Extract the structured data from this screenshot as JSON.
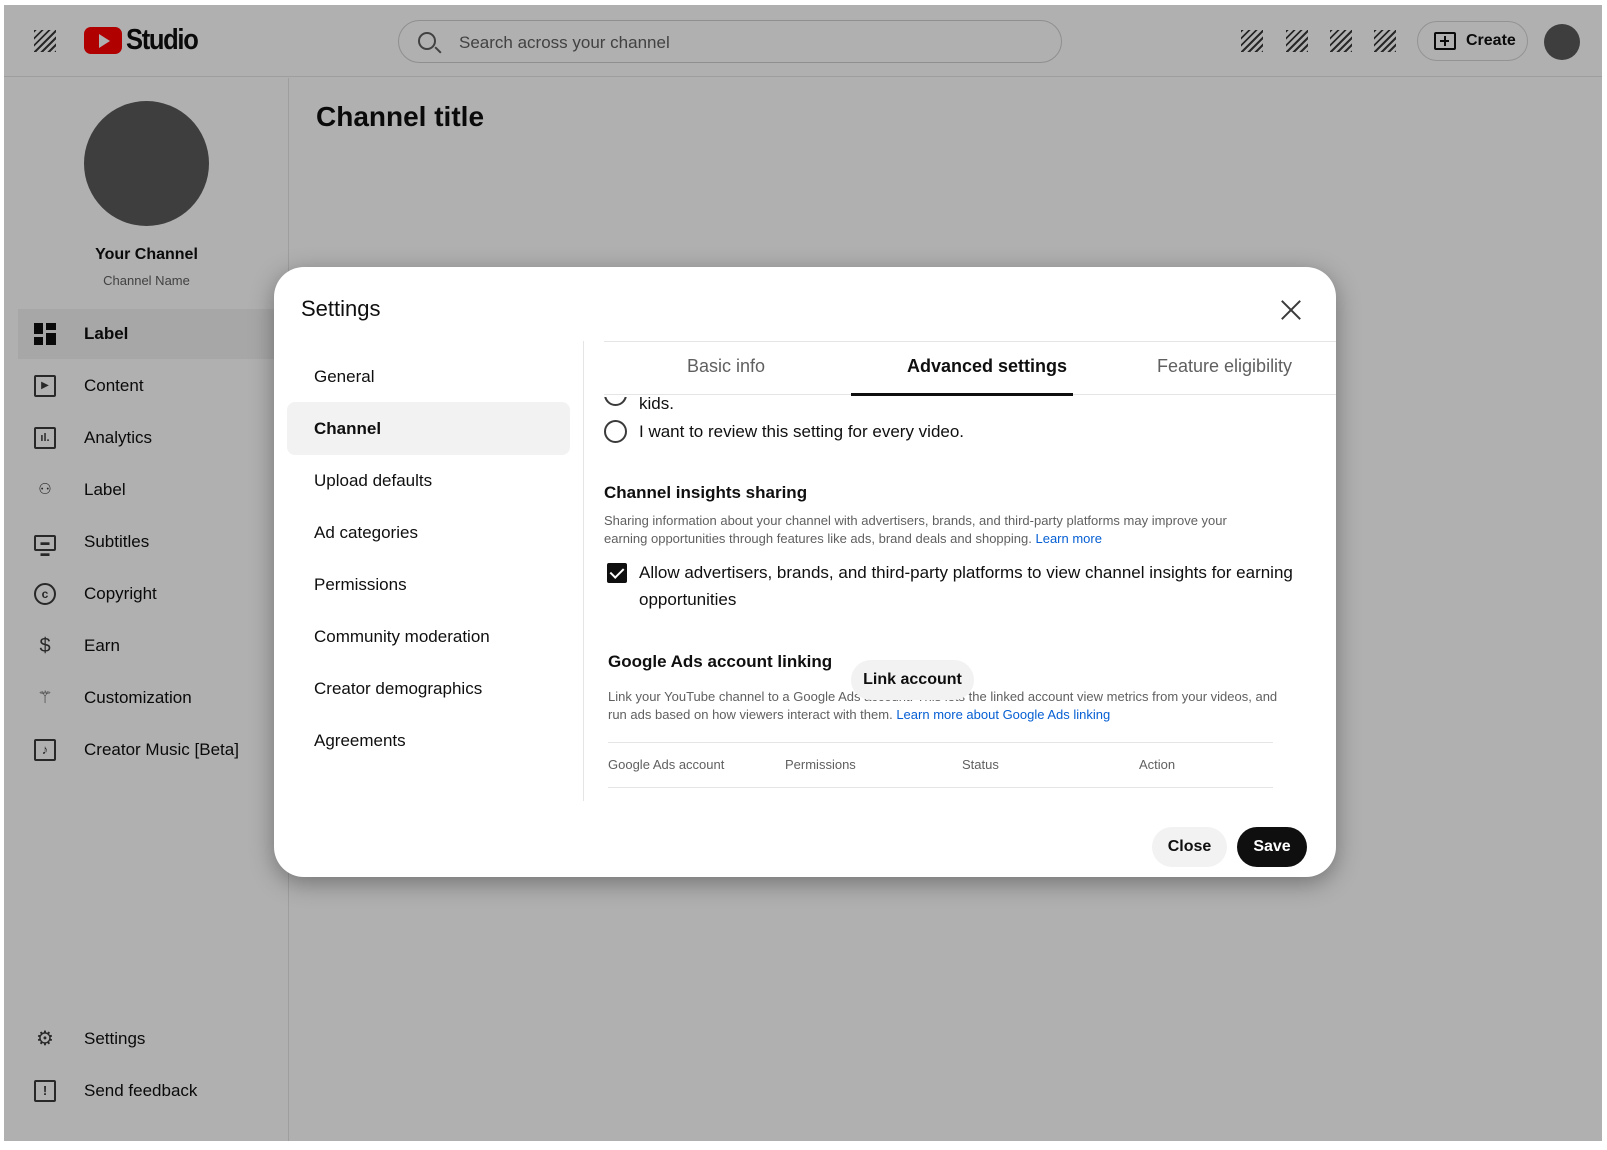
{
  "topbar": {
    "logo_text": "Studio",
    "search_placeholder": "Search across your channel",
    "create_label": "Create"
  },
  "page": {
    "title": "Channel title"
  },
  "sidebar": {
    "channel_name": "Your Channel",
    "channel_handle": "Channel Name",
    "items": [
      {
        "label": "Label",
        "icon": "dashboard-icon"
      },
      {
        "label": "Content",
        "icon": "content-icon"
      },
      {
        "label": "Analytics",
        "icon": "analytics-icon"
      },
      {
        "label": "Label",
        "icon": "community-icon"
      },
      {
        "label": "Subtitles",
        "icon": "subtitles-icon"
      },
      {
        "label": "Copyright",
        "icon": "copyright-icon"
      },
      {
        "label": "Earn",
        "icon": "earn-icon"
      },
      {
        "label": "Customization",
        "icon": "customization-icon"
      },
      {
        "label": "Creator Music [Beta]",
        "icon": "music-icon"
      }
    ],
    "bottom": [
      {
        "label": "Settings",
        "icon": "gear-icon"
      },
      {
        "label": "Send feedback",
        "icon": "feedback-icon"
      }
    ]
  },
  "dialog": {
    "title": "Settings",
    "nav": [
      "General",
      "Channel",
      "Upload defaults",
      "Ad categories",
      "Permissions",
      "Community moderation",
      "Creator demographics",
      "Agreements"
    ],
    "tabs": [
      "Basic info",
      "Advanced settings",
      "Feature eligibility"
    ],
    "content": {
      "partial_text": "kids.",
      "radio_review": "I want to review this setting for every video.",
      "insights_title": "Channel insights sharing",
      "insights_desc_1": "Sharing information about your channel with advertisers, brands, and third-party platforms may improve your",
      "insights_desc_2": "earning opportunities through features like ads, brand deals and shopping.",
      "insights_link": "Learn more",
      "checkbox_line_1": "Allow advertisers, brands, and third-party platforms to view channel insights for earning",
      "checkbox_line_2": "opportunities",
      "ads_title": "Google Ads account linking",
      "link_account": "Link account",
      "ads_desc_1": "Link your YouTube channel to a Google Ads account.  This lets the linked account view metrics from your videos, and",
      "ads_desc_2": "run ads based on how viewers interact with them.",
      "ads_link": "Learn more about Google Ads linking",
      "table_headers": [
        "Google Ads account",
        "Permissions",
        "Status",
        "Action"
      ]
    },
    "close_label": "Close",
    "save_label": "Save"
  }
}
